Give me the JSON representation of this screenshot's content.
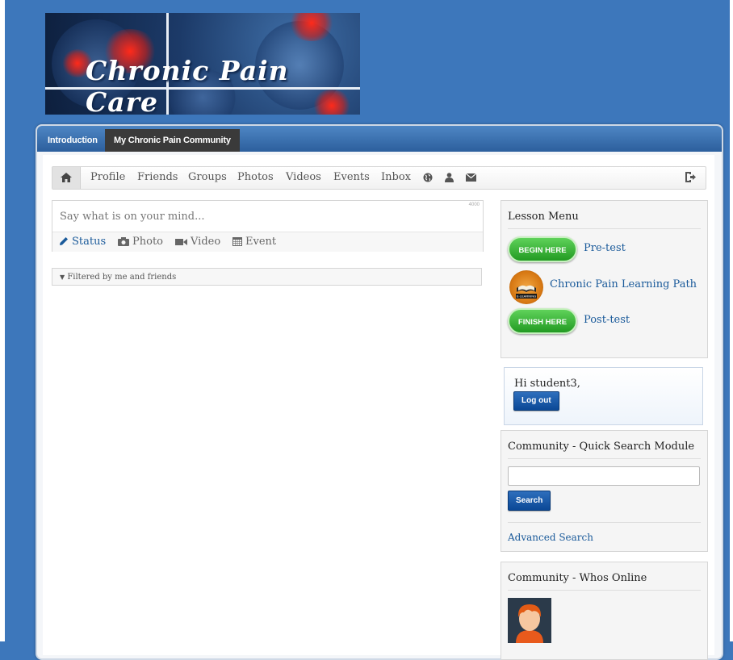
{
  "banner": {
    "logo_text": "Chronic Pain Care"
  },
  "topnav": {
    "tabs": [
      {
        "label": "Introduction"
      },
      {
        "label": "My Chronic Pain Community"
      }
    ]
  },
  "toolbar": {
    "items": [
      {
        "label": "Profile"
      },
      {
        "label": "Friends"
      },
      {
        "label": "Groups"
      },
      {
        "label": "Photos"
      },
      {
        "label": "Videos"
      },
      {
        "label": "Events"
      },
      {
        "label": "Inbox"
      }
    ],
    "icons": [
      "home-icon",
      "globe-icon",
      "user-icon",
      "envelope-icon",
      "logout-icon"
    ]
  },
  "status_box": {
    "placeholder": "Say what is on your mind...",
    "counter": "4000",
    "tabs": [
      {
        "label": "Status",
        "icon": "pencil-icon"
      },
      {
        "label": "Photo",
        "icon": "camera-icon"
      },
      {
        "label": "Video",
        "icon": "video-camera-icon"
      },
      {
        "label": "Event",
        "icon": "calendar-icon"
      }
    ]
  },
  "filter": {
    "label": "Filtered by me and friends"
  },
  "lesson_menu": {
    "title": "Lesson Menu",
    "items": [
      {
        "button": "BEGIN HERE",
        "link": "Pre-test"
      },
      {
        "badge": "E-LEARNING",
        "link": "Chronic Pain Learning Path"
      },
      {
        "button": "FINISH HERE",
        "link": "Post-test"
      }
    ]
  },
  "greeting": {
    "text": "Hi student3,",
    "logout": "Log out"
  },
  "quick_search": {
    "title": "Community - Quick Search Module",
    "button": "Search",
    "advanced": "Advanced Search"
  },
  "whos_online": {
    "title": "Community - Whos Online"
  },
  "colors": {
    "background": "#3d77bb",
    "nav_blue": "#2c5f9d",
    "link_blue": "#1a5a9a",
    "pill_green": "#229a22"
  }
}
